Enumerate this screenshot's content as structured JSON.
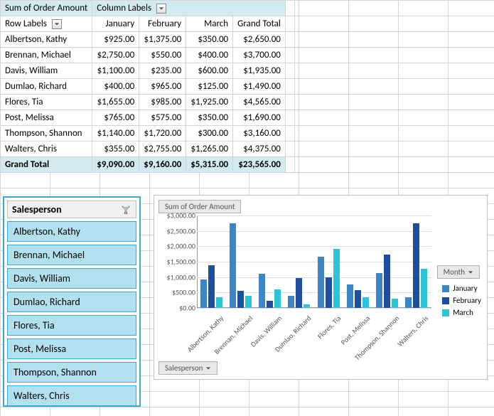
{
  "colors": {
    "jan": "#3f85c6",
    "feb": "#1f4e9c",
    "mar": "#2dc4d8"
  },
  "pivot": {
    "title": "Sum of Order Amount",
    "col_header_label": "Column Labels",
    "row_header_label": "Row Labels",
    "months": [
      "January",
      "February",
      "March"
    ],
    "grand_total_label": "Grand Total",
    "rows": [
      {
        "name": "Albertson, Kathy",
        "vals": [
          "$925.00",
          "$1,375.00",
          "$350.00"
        ],
        "total": "$2,650.00"
      },
      {
        "name": "Brennan, Michael",
        "vals": [
          "$2,750.00",
          "$550.00",
          "$400.00"
        ],
        "total": "$3,700.00"
      },
      {
        "name": "Davis, William",
        "vals": [
          "$1,100.00",
          "$235.00",
          "$600.00"
        ],
        "total": "$1,935.00"
      },
      {
        "name": "Dumlao, Richard",
        "vals": [
          "$400.00",
          "$965.00",
          "$125.00"
        ],
        "total": "$1,490.00"
      },
      {
        "name": "Flores, Tia",
        "vals": [
          "$1,655.00",
          "$985.00",
          "$1,925.00"
        ],
        "total": "$4,565.00"
      },
      {
        "name": "Post, Melissa",
        "vals": [
          "$765.00",
          "$575.00",
          "$350.00"
        ],
        "total": "$1,690.00"
      },
      {
        "name": "Thompson, Shannon",
        "vals": [
          "$1,140.00",
          "$1,720.00",
          "$300.00"
        ],
        "total": "$3,160.00"
      },
      {
        "name": "Walters, Chris",
        "vals": [
          "$355.00",
          "$2,755.00",
          "$1,265.00"
        ],
        "total": "$4,375.00"
      }
    ],
    "totals": {
      "vals": [
        "$9,090.00",
        "$9,160.00",
        "$5,315.00"
      ],
      "grand": "$23,565.00"
    }
  },
  "slicer": {
    "title": "Salesperson",
    "items": [
      "Albertson, Kathy",
      "Brennan, Michael",
      "Davis, William",
      "Dumlao, Richard",
      "Flores, Tia",
      "Post, Melissa",
      "Thompson, Shannon",
      "Walters, Chris"
    ]
  },
  "chart": {
    "sum_button": "Sum of Order Amount",
    "salesperson_button": "Salesperson",
    "month_button": "Month",
    "legend": [
      "January",
      "February",
      "March"
    ]
  },
  "chart_data": {
    "type": "bar",
    "title": "Sum of Order Amount",
    "ylabel": "",
    "xlabel": "",
    "ylim": [
      0,
      3000
    ],
    "yticks": [
      "$0.00",
      "$500.00",
      "$1,000.00",
      "$1,500.00",
      "$2,000.00",
      "$2,500.00",
      "$3,000.00"
    ],
    "categories": [
      "Albertson, Kathy",
      "Brennan, Michael",
      "Davis, William",
      "Dumlao, Richard",
      "Flores, Tia",
      "Post, Melissa",
      "Thompson, Shannon",
      "Walters, Chris"
    ],
    "series": [
      {
        "name": "January",
        "values": [
          925,
          2750,
          1100,
          400,
          1655,
          765,
          1140,
          355
        ]
      },
      {
        "name": "February",
        "values": [
          1375,
          550,
          235,
          965,
          985,
          575,
          1720,
          2755
        ]
      },
      {
        "name": "March",
        "values": [
          350,
          400,
          600,
          125,
          1925,
          350,
          300,
          1265
        ]
      }
    ]
  }
}
